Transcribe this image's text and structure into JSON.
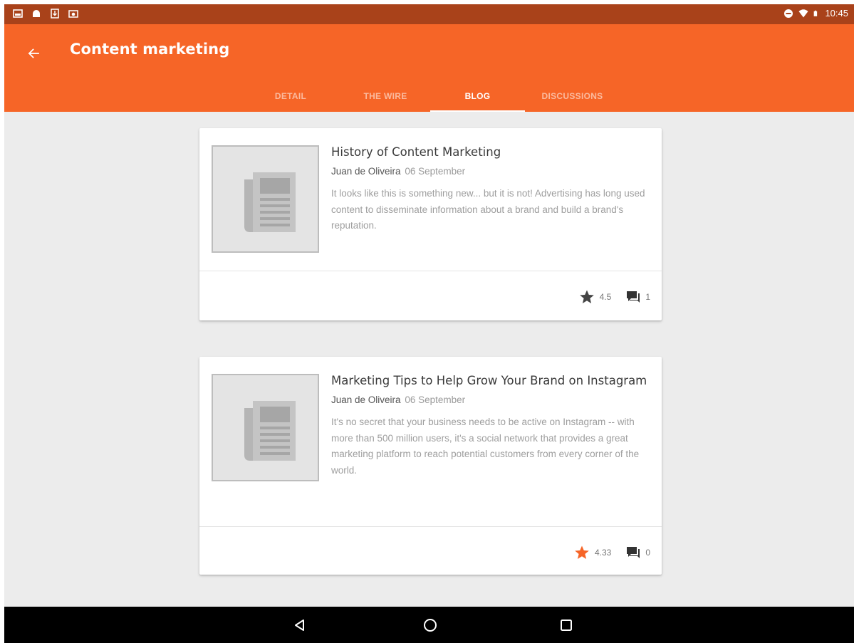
{
  "status_bar": {
    "time": "10:45",
    "left_icons": [
      "image-notification-icon",
      "android-notification-icon",
      "download-notification-icon",
      "cast-notification-icon"
    ],
    "right_icons": [
      "do-not-disturb-icon",
      "wifi-icon",
      "battery-icon"
    ]
  },
  "app_bar": {
    "title": "Content marketing",
    "back_icon": "arrow-back-icon",
    "background_color": "#f66527"
  },
  "tabs": [
    {
      "label": "DETAIL",
      "active": false
    },
    {
      "label": "THE WIRE",
      "active": false
    },
    {
      "label": "BLOG",
      "active": true
    },
    {
      "label": "DISCUSSIONS",
      "active": false
    }
  ],
  "posts": [
    {
      "title": "History of Content Marketing",
      "author": "Juan de Oliveira",
      "date": "06 September",
      "excerpt": "It looks like this is something new... but it is not! Advertising has long used content to disseminate information about a brand and build a brand's reputation.",
      "rating": "4.5",
      "rating_highlighted": false,
      "comments": "1"
    },
    {
      "title": "Marketing Tips to Help Grow Your Brand on Instagram",
      "author": "Juan de Oliveira",
      "date": "06 September",
      "excerpt": "It's no secret that your business needs to be active on Instagram -- with more than 500 million users, it's a social network that provides a great marketing platform to reach potential customers from every corner of the world.",
      "rating": "4.33",
      "rating_highlighted": true,
      "comments": "0"
    }
  ],
  "colors": {
    "accent": "#f66527",
    "status_bar": "#a9421a",
    "star_default": "#444444",
    "star_highlight": "#f66527"
  },
  "nav_bar": {
    "buttons": [
      "back-nav-icon",
      "home-nav-icon",
      "recents-nav-icon"
    ]
  }
}
